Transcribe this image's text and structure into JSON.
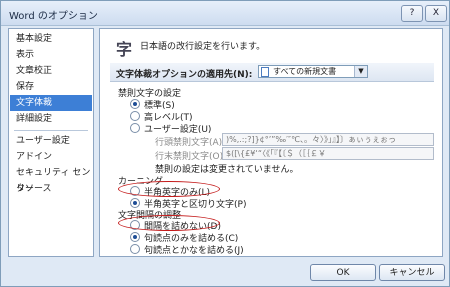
{
  "window": {
    "title": "Word のオプション",
    "help_glyph": "?",
    "close_glyph": "X"
  },
  "sidebar": {
    "items": [
      {
        "label": "基本設定"
      },
      {
        "label": "表示"
      },
      {
        "label": "文章校正"
      },
      {
        "label": "保存"
      },
      {
        "label": "文字体裁"
      },
      {
        "label": "詳細設定"
      },
      {
        "label": "ユーザー設定"
      },
      {
        "label": "アドイン"
      },
      {
        "label": "セキュリティ センター"
      },
      {
        "label": "リソース"
      }
    ],
    "active_index": 4
  },
  "main": {
    "header_icon": "字",
    "header_text": "日本語の改行設定を行います。",
    "apply_to_label": "文字体裁オプションの適用先(N):",
    "apply_to_value": "すべての新規文書",
    "kinsoku": {
      "title": "禁則文字の設定",
      "options": [
        {
          "label": "標準(S)",
          "selected": true
        },
        {
          "label": "高レベル(T)",
          "selected": false
        },
        {
          "label": "ユーザー設定(U)",
          "selected": false
        }
      ],
      "line_start_label": "行頭禁則文字(A)",
      "line_start_value": ")%,.:;?]}¢°’”‰′″℃、。々〉》」』】〕ぁぃぅぇぉっ",
      "line_end_label": "行末禁則文字(O)",
      "line_end_value": "$([\\{£¥‘“〈《「『【〔＄（［｛￡￥",
      "note": "禁則の設定は変更されていません。"
    },
    "kerning": {
      "title": "カーニング",
      "options": [
        {
          "label": "半角英字のみ(L)",
          "selected": false
        },
        {
          "label": "半角英字と区切り文字(P)",
          "selected": true
        }
      ]
    },
    "spacing": {
      "title": "文字間隔の調整",
      "options": [
        {
          "label": "間隔を詰めない(D)",
          "selected": false
        },
        {
          "label": "句読点のみを詰める(C)",
          "selected": true
        },
        {
          "label": "句読点とかなを詰める(J)",
          "selected": false
        }
      ]
    }
  },
  "footer": {
    "ok_label": "OK",
    "cancel_label": "キャンセル"
  }
}
